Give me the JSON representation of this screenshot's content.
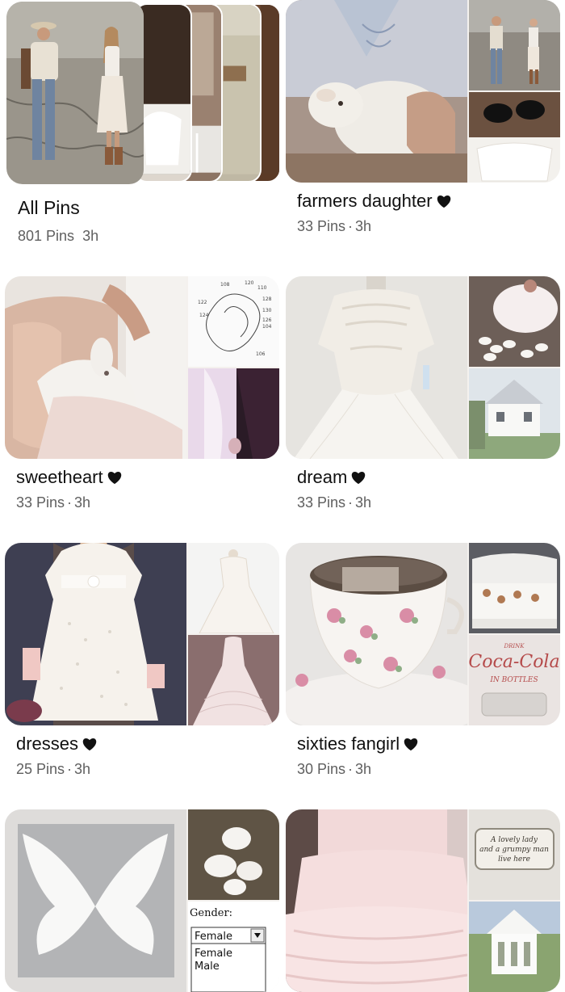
{
  "boards": [
    {
      "title": "All Pins",
      "count": "801 Pins",
      "time": "3h",
      "heart": false,
      "stack": true
    },
    {
      "title": "farmers daughter",
      "count": "33 Pins",
      "time": "3h",
      "heart": true
    },
    {
      "title": "sweetheart",
      "count": "33 Pins",
      "time": "3h",
      "heart": true
    },
    {
      "title": "dream",
      "count": "33 Pins",
      "time": "3h",
      "heart": true
    },
    {
      "title": "dresses",
      "count": "25 Pins",
      "time": "3h",
      "heart": true
    },
    {
      "title": "sixties fangirl",
      "count": "30 Pins",
      "time": "3h",
      "heart": true
    }
  ],
  "separator": "·",
  "image_text": {
    "coca_cola_top": "DRINK",
    "coca_cola_logo": "Coca-Cola",
    "coca_cola_bottom": "IN BOTTLES",
    "sign_line1": "A lovely lady",
    "sign_line2": "and a grumpy man",
    "sign_line3": "live here",
    "gender_label": "Gender:",
    "gender_value": "Female",
    "gender_option1": "Female",
    "gender_option2": "Male",
    "patent_nums": [
      "108",
      "120",
      "110",
      "122",
      "128",
      "124",
      "130",
      "126",
      "104",
      "106"
    ]
  },
  "colors": {
    "text": "#111111",
    "meta": "#5f5f5f",
    "background": "#ffffff"
  }
}
